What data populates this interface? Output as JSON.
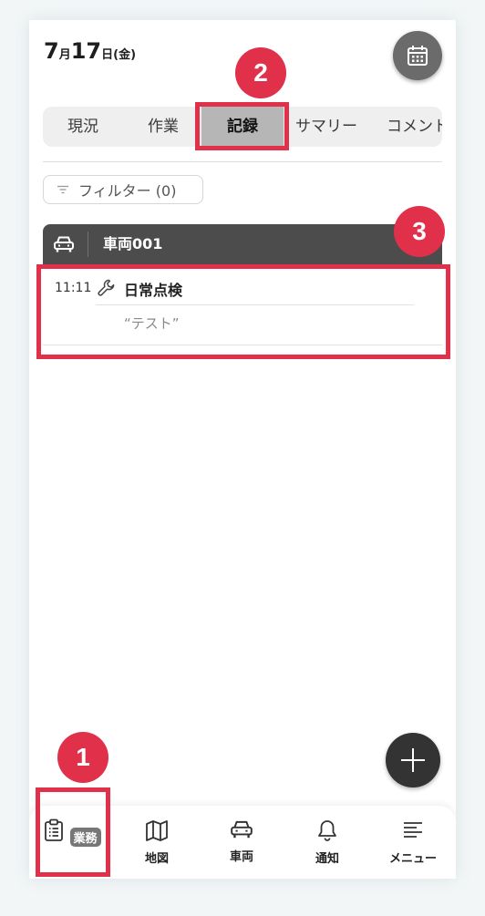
{
  "header": {
    "date_month": "7",
    "date_month_unit": "月",
    "date_day": "17",
    "date_day_unit": "日",
    "date_weekday": "(金)",
    "calendar_icon": "calendar-icon"
  },
  "tabs": [
    {
      "label": "現況",
      "active": false
    },
    {
      "label": "作業",
      "active": false
    },
    {
      "label": "記録",
      "active": true
    },
    {
      "label": "サマリー",
      "active": false
    },
    {
      "label": "コメント",
      "active": false
    }
  ],
  "filter": {
    "label": "フィルター (0)",
    "icon": "filter-icon"
  },
  "vehicle": {
    "name": "車両001",
    "icon": "car-icon"
  },
  "record": {
    "time": "11:11",
    "title": "日常点検",
    "note": "“テスト”",
    "icon": "wrench-icon"
  },
  "callouts": [
    "1",
    "2",
    "3"
  ],
  "callout_color": "#e0304a",
  "fab": {
    "icon": "plus-icon"
  },
  "bottom_nav": [
    {
      "label": "業務",
      "icon": "clipboard-icon",
      "active": true
    },
    {
      "label": "地図",
      "icon": "map-icon",
      "active": false
    },
    {
      "label": "車両",
      "icon": "car-icon",
      "active": false
    },
    {
      "label": "通知",
      "icon": "bell-icon",
      "active": false
    },
    {
      "label": "メニュー",
      "icon": "menu-icon",
      "active": false
    }
  ]
}
